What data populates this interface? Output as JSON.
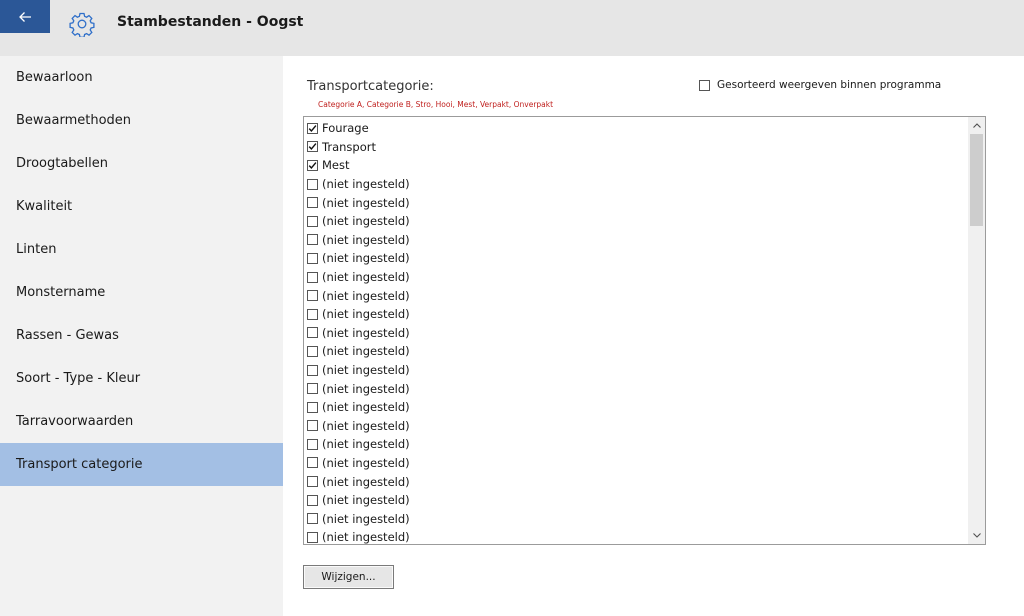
{
  "window": {
    "title": "Stambestanden - Oogst"
  },
  "sidebar": {
    "items": [
      {
        "label": "Bewaarloon",
        "active": false
      },
      {
        "label": "Bewaarmethoden",
        "active": false
      },
      {
        "label": "Droogtabellen",
        "active": false
      },
      {
        "label": "Kwaliteit",
        "active": false
      },
      {
        "label": "Linten",
        "active": false
      },
      {
        "label": "Monstername",
        "active": false
      },
      {
        "label": "Rassen - Gewas",
        "active": false
      },
      {
        "label": "Soort - Type - Kleur",
        "active": false
      },
      {
        "label": "Tarravoorwaarden",
        "active": false
      },
      {
        "label": "Transport categorie",
        "active": true
      }
    ]
  },
  "main": {
    "section_title": "Transportcategorie:",
    "hint": "Categorie A, Categorie B, Stro, Hooi, Mest, Verpakt, Onverpakt",
    "sorted_option": {
      "label": "Gesorteerd weergeven binnen programma",
      "checked": false
    },
    "list": [
      {
        "label": "Fourage",
        "checked": true
      },
      {
        "label": "Transport",
        "checked": true
      },
      {
        "label": "Mest",
        "checked": true
      },
      {
        "label": "(niet ingesteld)",
        "checked": false
      },
      {
        "label": "(niet ingesteld)",
        "checked": false
      },
      {
        "label": "(niet ingesteld)",
        "checked": false
      },
      {
        "label": "(niet ingesteld)",
        "checked": false
      },
      {
        "label": "(niet ingesteld)",
        "checked": false
      },
      {
        "label": "(niet ingesteld)",
        "checked": false
      },
      {
        "label": "(niet ingesteld)",
        "checked": false
      },
      {
        "label": "(niet ingesteld)",
        "checked": false
      },
      {
        "label": "(niet ingesteld)",
        "checked": false
      },
      {
        "label": "(niet ingesteld)",
        "checked": false
      },
      {
        "label": "(niet ingesteld)",
        "checked": false
      },
      {
        "label": "(niet ingesteld)",
        "checked": false
      },
      {
        "label": "(niet ingesteld)",
        "checked": false
      },
      {
        "label": "(niet ingesteld)",
        "checked": false
      },
      {
        "label": "(niet ingesteld)",
        "checked": false
      },
      {
        "label": "(niet ingesteld)",
        "checked": false
      },
      {
        "label": "(niet ingesteld)",
        "checked": false
      },
      {
        "label": "(niet ingesteld)",
        "checked": false
      },
      {
        "label": "(niet ingesteld)",
        "checked": false
      },
      {
        "label": "(niet ingesteld)",
        "checked": false
      }
    ],
    "change_button": "Wijzigen..."
  },
  "icons": {
    "back": "arrow-left-icon",
    "settings": "gear-icon",
    "scroll_up": "chevron-up-icon",
    "scroll_down": "chevron-down-icon",
    "check": "checkmark-icon"
  },
  "colors": {
    "accent": "#2b5797",
    "selected_nav": "#a3bfe4",
    "gear": "#2f6fc9",
    "hint_text": "#c0211f"
  }
}
